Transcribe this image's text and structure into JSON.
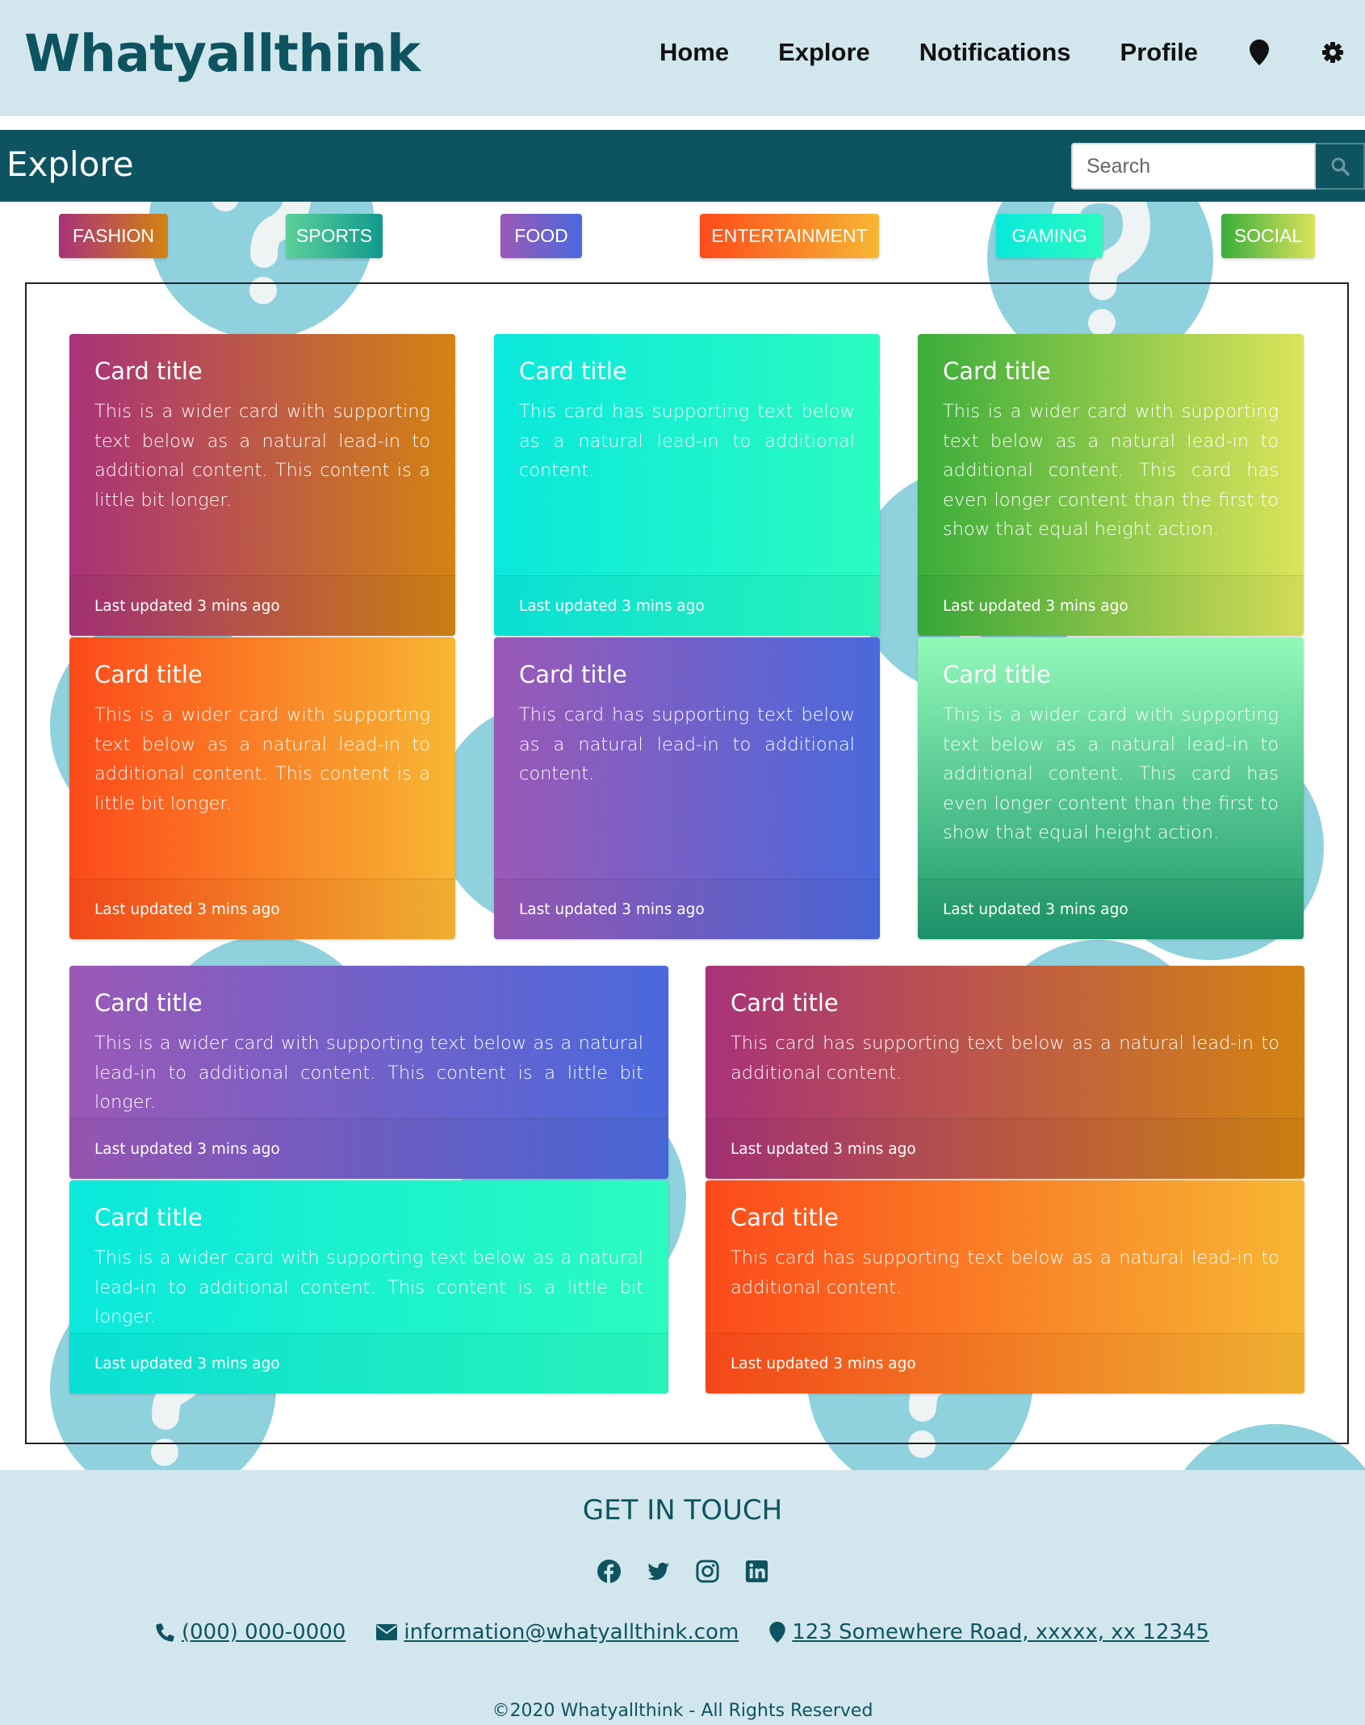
{
  "header": {
    "brand": "Whatyallthink",
    "nav": [
      {
        "label": "Home"
      },
      {
        "label": "Explore"
      },
      {
        "label": "Notifications"
      },
      {
        "label": "Profile"
      }
    ],
    "icons": [
      "map-marker-icon",
      "gear-icon"
    ]
  },
  "explore": {
    "title": "Explore",
    "search_placeholder": "Search"
  },
  "categories": [
    {
      "label": "FASHION",
      "colors": [
        "#a83279",
        "#d38312"
      ]
    },
    {
      "label": "SPORTS",
      "colors": [
        "#5bd19a",
        "#11998e"
      ]
    },
    {
      "label": "FOOD",
      "colors": [
        "#9b59b6",
        "#4a69dc"
      ]
    },
    {
      "label": "ENTERTAINMENT",
      "colors": [
        "#fc4a1a",
        "#f7b733"
      ]
    },
    {
      "label": "GAMING",
      "colors": [
        "#0be8dc",
        "#2afbc0"
      ]
    },
    {
      "label": "SOCIAL",
      "colors": [
        "#3aad3a",
        "#dce35b"
      ]
    }
  ],
  "cards": [
    {
      "title": "Card title",
      "text": "This is a wider card with supporting text below as a natural lead-in to additional content. This content is a little bit longer.",
      "footer": "Last updated 3 mins ago"
    },
    {
      "title": "Card title",
      "text": "This card has supporting text below as a natural lead-in to additional content.",
      "footer": "Last updated 3 mins ago"
    },
    {
      "title": "Card title",
      "text": "This is a wider card with supporting text below as a natural lead-in to additional content. This card has even longer content than the first to show that equal height action.",
      "footer": "Last updated 3 mins ago"
    },
    {
      "title": "Card title",
      "text": "This is a wider card with supporting text below as a natural lead-in to additional content. This content is a little bit longer.",
      "footer": "Last updated 3 mins ago"
    },
    {
      "title": "Card title",
      "text": "This card has supporting text below as a natural lead-in to additional content.",
      "footer": "Last updated 3 mins ago"
    },
    {
      "title": "Card title",
      "text": "This is a wider card with supporting text below as a natural lead-in to additional content. This card has even longer content than the first to show that equal height action.",
      "footer": "Last updated 3 mins ago"
    },
    {
      "title": "Card title",
      "text": "This is a wider card with supporting text below as a natural lead-in to additional content. This content is a little bit longer.",
      "footer": "Last updated 3 mins ago"
    },
    {
      "title": "Card title",
      "text": "This card has supporting text below as a natural lead-in to additional content.",
      "footer": "Last updated 3 mins ago"
    },
    {
      "title": "Card title",
      "text": "This is a wider card with supporting text below as a natural lead-in to additional content. This content is a little bit longer.",
      "footer": "Last updated 3 mins ago"
    },
    {
      "title": "Card title",
      "text": "This card has supporting text below as a natural lead-in to additional content.",
      "footer": "Last updated 3 mins ago"
    }
  ],
  "footer": {
    "heading": "GET IN TOUCH",
    "social_icons": [
      "facebook-icon",
      "twitter-icon",
      "instagram-icon",
      "linkedin-icon"
    ],
    "phone": " (000) 000-0000",
    "email": " information@whatyallthink.com",
    "address": " 123 Somewhere Road, xxxxx, xx 12345",
    "copyright": "©2020 Whatyallthink - All Rights Reserved"
  },
  "colors": {
    "brand": "#0e5460",
    "header_bg": "#d2e7ed",
    "bg_circle": "#90d1de"
  }
}
